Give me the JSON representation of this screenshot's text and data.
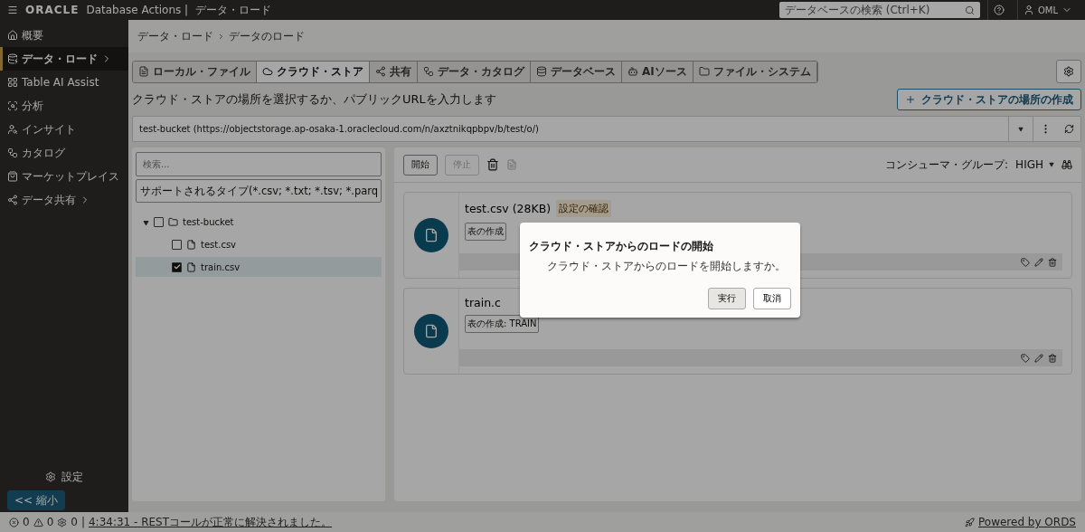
{
  "topbar": {
    "brand": "ORACLE",
    "product": "Database Actions |",
    "page": "データ・ロード",
    "search_placeholder": "データベースの検索 (Ctrl+K)",
    "user": "OML"
  },
  "sidebar": {
    "items": [
      {
        "label": "概要",
        "selected": false,
        "submenu": false
      },
      {
        "label": "データ・ロード",
        "selected": true,
        "submenu": true
      },
      {
        "label": "Table AI Assist",
        "selected": false,
        "submenu": false
      },
      {
        "label": "分析",
        "selected": false,
        "submenu": false
      },
      {
        "label": "インサイト",
        "selected": false,
        "submenu": false
      },
      {
        "label": "カタログ",
        "selected": false,
        "submenu": false
      },
      {
        "label": "マーケットプレイス",
        "selected": false,
        "submenu": false
      },
      {
        "label": "データ共有",
        "selected": false,
        "submenu": true
      }
    ],
    "settings": "設定",
    "collapse": "縮小",
    "collapse_arrows": "<<"
  },
  "breadcrumb": [
    "データ・ロード",
    "データのロード"
  ],
  "tabs": [
    {
      "label": "ローカル・ファイル",
      "selected": false
    },
    {
      "label": "クラウド・ストア",
      "selected": true
    },
    {
      "label": "共有",
      "selected": false
    },
    {
      "label": "データ・カタログ",
      "selected": false
    },
    {
      "label": "データベース",
      "selected": false
    },
    {
      "label": "AIソース",
      "selected": false
    },
    {
      "label": "ファイル・システム",
      "selected": false
    }
  ],
  "heading": "クラウド・ストアの場所を選択するか、パブリックURLを入力します",
  "create_button": "クラウド・ストアの場所の作成",
  "location": "test-bucket (https://objectstorage.ap-osaka-1.oraclecloud.com/n/axztnikqpbpv/b/test/o/)",
  "left_panel": {
    "search_placeholder": "検索...",
    "filter": "サポートされるタイプ(*.csv; *.txt; *.tsv; *.parq",
    "tree": [
      {
        "label": "test-bucket",
        "checked": false,
        "expanded": true,
        "selected": false,
        "children": [
          {
            "label": "test.csv",
            "checked": false,
            "selected": false
          },
          {
            "label": "train.csv",
            "checked": true,
            "selected": true
          }
        ]
      }
    ]
  },
  "toolbar": {
    "start": "開始",
    "stop": "停止",
    "stop_disabled": true,
    "consumer_label": "コンシューマ・グループ:",
    "consumer_value": "HIGH"
  },
  "cards": [
    {
      "title": "test.csv (28KB)",
      "badge": "設定の確認",
      "tag": "表の作成"
    },
    {
      "title": "train.c",
      "tag": "表の作成: TRAIN"
    }
  ],
  "dialog": {
    "title": "クラウド・ストアからのロードの開始",
    "message": "クラウド・ストアからのロードを開始しますか。",
    "buttons": [
      {
        "label": "実行",
        "primary": true
      },
      {
        "label": "取消",
        "primary": false
      }
    ]
  },
  "status_bar": {
    "errors": "0",
    "warnings": "0",
    "jobs": "0",
    "separator": "|",
    "message": "4:34:31 - RESTコールが正常に解決されました。",
    "powered": "Powered by ORDS"
  }
}
